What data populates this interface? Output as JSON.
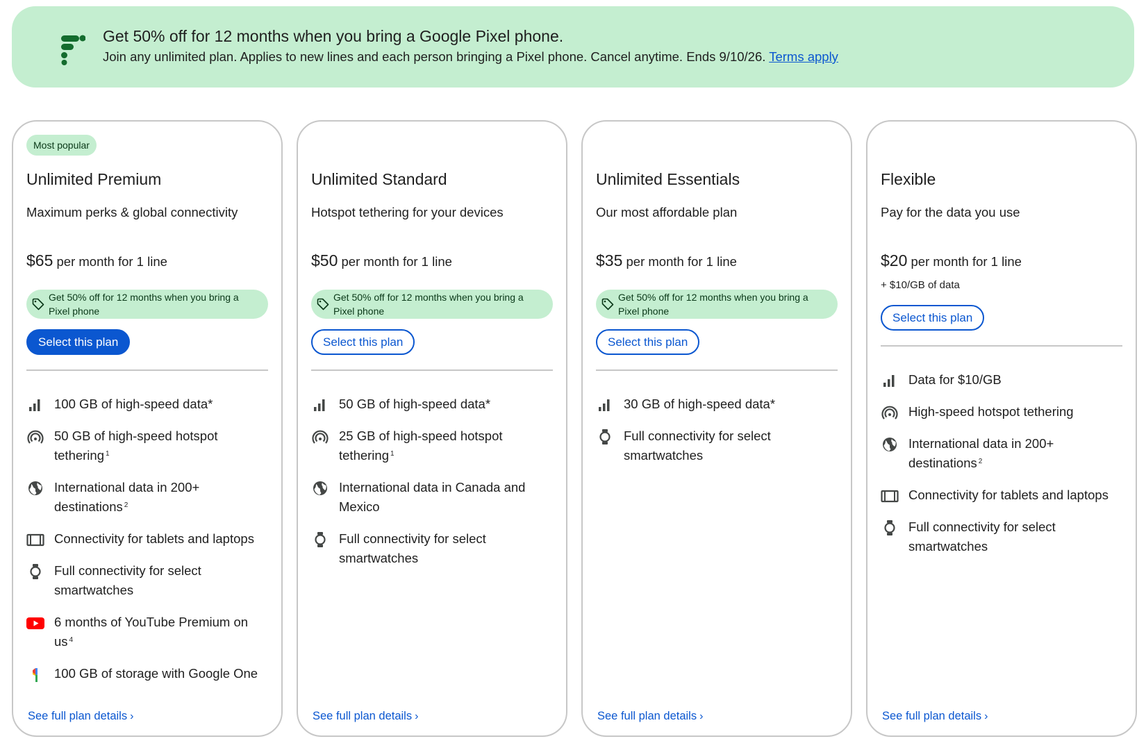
{
  "banner": {
    "title": "Get 50% off for 12 months when you bring a Google Pixel phone.",
    "text": "Join any unlimited plan. Applies to new lines and each person bringing a Pixel phone. Cancel anytime. Ends 9/10/26.",
    "link": "Terms apply",
    "logo_icon": "google-fi-logo"
  },
  "colors": {
    "accent": "#0b57d0",
    "promo_bg": "#c4eed0",
    "promo_text": "#0a3818",
    "border": "#c7c7c7"
  },
  "plans": [
    {
      "badge": "Most popular",
      "title": "Unlimited Premium",
      "subtitle": "Maximum perks & global connectivity",
      "price": "$65",
      "price_suffix": " per month for 1 line",
      "promo": "Get 50% off for 12 months when you bring a Pixel phone",
      "button": "Select this plan",
      "button_style": "filled",
      "features": [
        {
          "icon": "signal-bars-icon",
          "text": "100 GB of high-speed data*",
          "note": ""
        },
        {
          "icon": "hotspot-icon",
          "text": "50 GB of high-speed hotspot tethering",
          "note": "1"
        },
        {
          "icon": "globe-icon",
          "text": "International data in 200+ destinations",
          "note": "2"
        },
        {
          "icon": "tablet-icon",
          "text": "Connectivity for tablets and laptops",
          "note": ""
        },
        {
          "icon": "smartwatch-icon",
          "text": "Full connectivity for select smartwatches",
          "note": ""
        },
        {
          "icon": "youtube-icon",
          "text": "6 months of YouTube Premium on us",
          "note": "4"
        },
        {
          "icon": "google-one-icon",
          "text": "100 GB of storage with Google One",
          "note": ""
        }
      ],
      "details_link": "See full plan details"
    },
    {
      "badge": "",
      "title": "Unlimited Standard",
      "subtitle": "Hotspot tethering for your devices",
      "price": "$50",
      "price_suffix": " per month for 1 line",
      "promo": "Get 50% off for 12 months when you bring a Pixel phone",
      "button": "Select this plan",
      "button_style": "outline",
      "features": [
        {
          "icon": "signal-bars-icon",
          "text": "50 GB of high-speed data*",
          "note": ""
        },
        {
          "icon": "hotspot-icon",
          "text": "25 GB of high-speed hotspot tethering",
          "note": "1"
        },
        {
          "icon": "globe-icon",
          "text": "International data in Canada and Mexico",
          "note": ""
        },
        {
          "icon": "smartwatch-icon",
          "text": "Full connectivity for select smartwatches",
          "note": ""
        }
      ],
      "details_link": "See full plan details"
    },
    {
      "badge": "",
      "title": "Unlimited Essentials",
      "subtitle": "Our most affordable plan",
      "price": "$35",
      "price_suffix": " per month for 1 line",
      "promo": "Get 50% off for 12 months when you bring a Pixel phone",
      "button": "Select this plan",
      "button_style": "outline",
      "features": [
        {
          "icon": "signal-bars-icon",
          "text": "30 GB of high-speed data*",
          "note": ""
        },
        {
          "icon": "smartwatch-icon",
          "text": "Full connectivity for select smartwatches",
          "note": ""
        }
      ],
      "details_link": "See full plan details"
    },
    {
      "badge": "",
      "title": "Flexible",
      "subtitle": "Pay for the data you use",
      "price": "$20",
      "price_suffix": " per month for 1 line",
      "data_extra": "+ $10/GB of data",
      "promo": "",
      "button": "Select this plan",
      "button_style": "outline",
      "features": [
        {
          "icon": "signal-bars-icon",
          "text": "Data for $10/GB",
          "note": ""
        },
        {
          "icon": "hotspot-icon",
          "text": "High-speed hotspot tethering",
          "note": ""
        },
        {
          "icon": "globe-icon",
          "text": "International data in 200+ destinations",
          "note": "2"
        },
        {
          "icon": "tablet-icon",
          "text": "Connectivity for tablets and laptops",
          "note": ""
        },
        {
          "icon": "smartwatch-icon",
          "text": "Full connectivity for select smartwatches",
          "note": ""
        }
      ],
      "details_link": "See full plan details"
    }
  ]
}
